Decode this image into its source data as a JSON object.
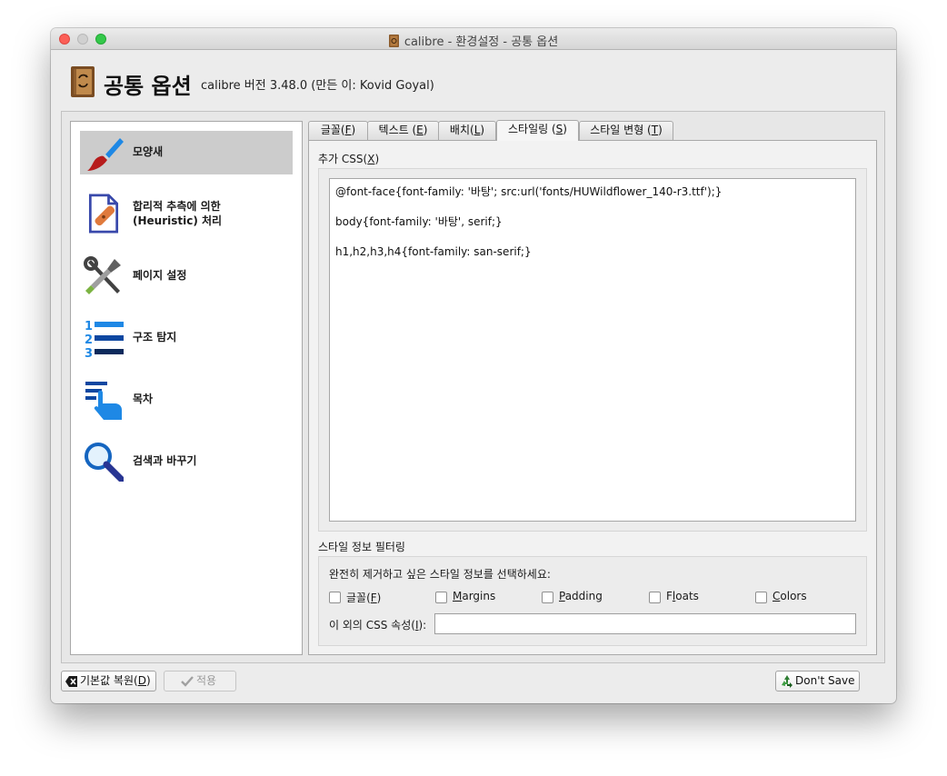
{
  "window": {
    "title": "calibre - 환경설정 - 공통 옵션"
  },
  "header": {
    "title": "공통 옵션",
    "subtitle": "calibre 버전 3.48.0 (만든 이: Kovid Goyal)"
  },
  "sidebar": {
    "items": [
      {
        "label": "모양새",
        "icon": "paintbrush-icon",
        "selected": true
      },
      {
        "label": "합리적 추측에 의한",
        "label2": "(Heuristic) 처리",
        "icon": "document-bandage-icon",
        "selected": false
      },
      {
        "label": "페이지 설정",
        "icon": "wrench-screwdriver-icon",
        "selected": false
      },
      {
        "label": "구조 탐지",
        "icon": "numbered-list-icon",
        "selected": false
      },
      {
        "label": "목차",
        "icon": "toc-hand-icon",
        "selected": false
      },
      {
        "label": "검색과 바꾸기",
        "icon": "magnifier-icon",
        "selected": false
      }
    ]
  },
  "tabs": [
    {
      "pre": "글꼴(",
      "key": "F",
      "post": ")"
    },
    {
      "pre": "텍스트 (",
      "key": "E",
      "post": ")"
    },
    {
      "pre": "배치(",
      "key": "L",
      "post": ")"
    },
    {
      "pre": "스타일링 (",
      "key": "S",
      "post": ")"
    },
    {
      "pre": "스타일 변형 (",
      "key": "T",
      "post": ")"
    }
  ],
  "styling": {
    "extra_css_label_pre": "추가 CSS(",
    "extra_css_label_key": "X",
    "extra_css_label_post": ")",
    "css_lines": [
      "@font-face{font-family: '바탕'; src:url('fonts/HUWildflower_140-r3.ttf');}",
      "body{font-family: '바탕', serif;}",
      "h1,h2,h3,h4{font-family: san-serif;}"
    ],
    "filter_group_label": "스타일 정보 필터링",
    "filter_prompt": "완전히 제거하고 싶은 스타일 정보를 선택하세요:",
    "filter_options": [
      {
        "pre": "글꼴(",
        "key": "F",
        "post": ")",
        "checked": false
      },
      {
        "pre": "",
        "key": "M",
        "post": "argins",
        "checked": false
      },
      {
        "pre": "",
        "key": "P",
        "post": "adding",
        "checked": false
      },
      {
        "pre": "F",
        "key": "l",
        "post": "oats",
        "checked": false
      },
      {
        "pre": "",
        "key": "C",
        "post": "olors",
        "checked": false
      }
    ],
    "other_css_label_pre": "이 외의 CSS 속성(",
    "other_css_label_key": "I",
    "other_css_label_post": "):",
    "other_css_value": ""
  },
  "footer": {
    "restore_pre": "기본값 복원(",
    "restore_key": "D",
    "restore_post": ")",
    "apply_label": "적용",
    "dont_save_label": "Don't Save"
  },
  "colors": {
    "selected_item_bg": "#cccccc",
    "close_button": "#fc5f57",
    "maximize_button": "#34c84a",
    "icon_blue": "#1565c0"
  }
}
